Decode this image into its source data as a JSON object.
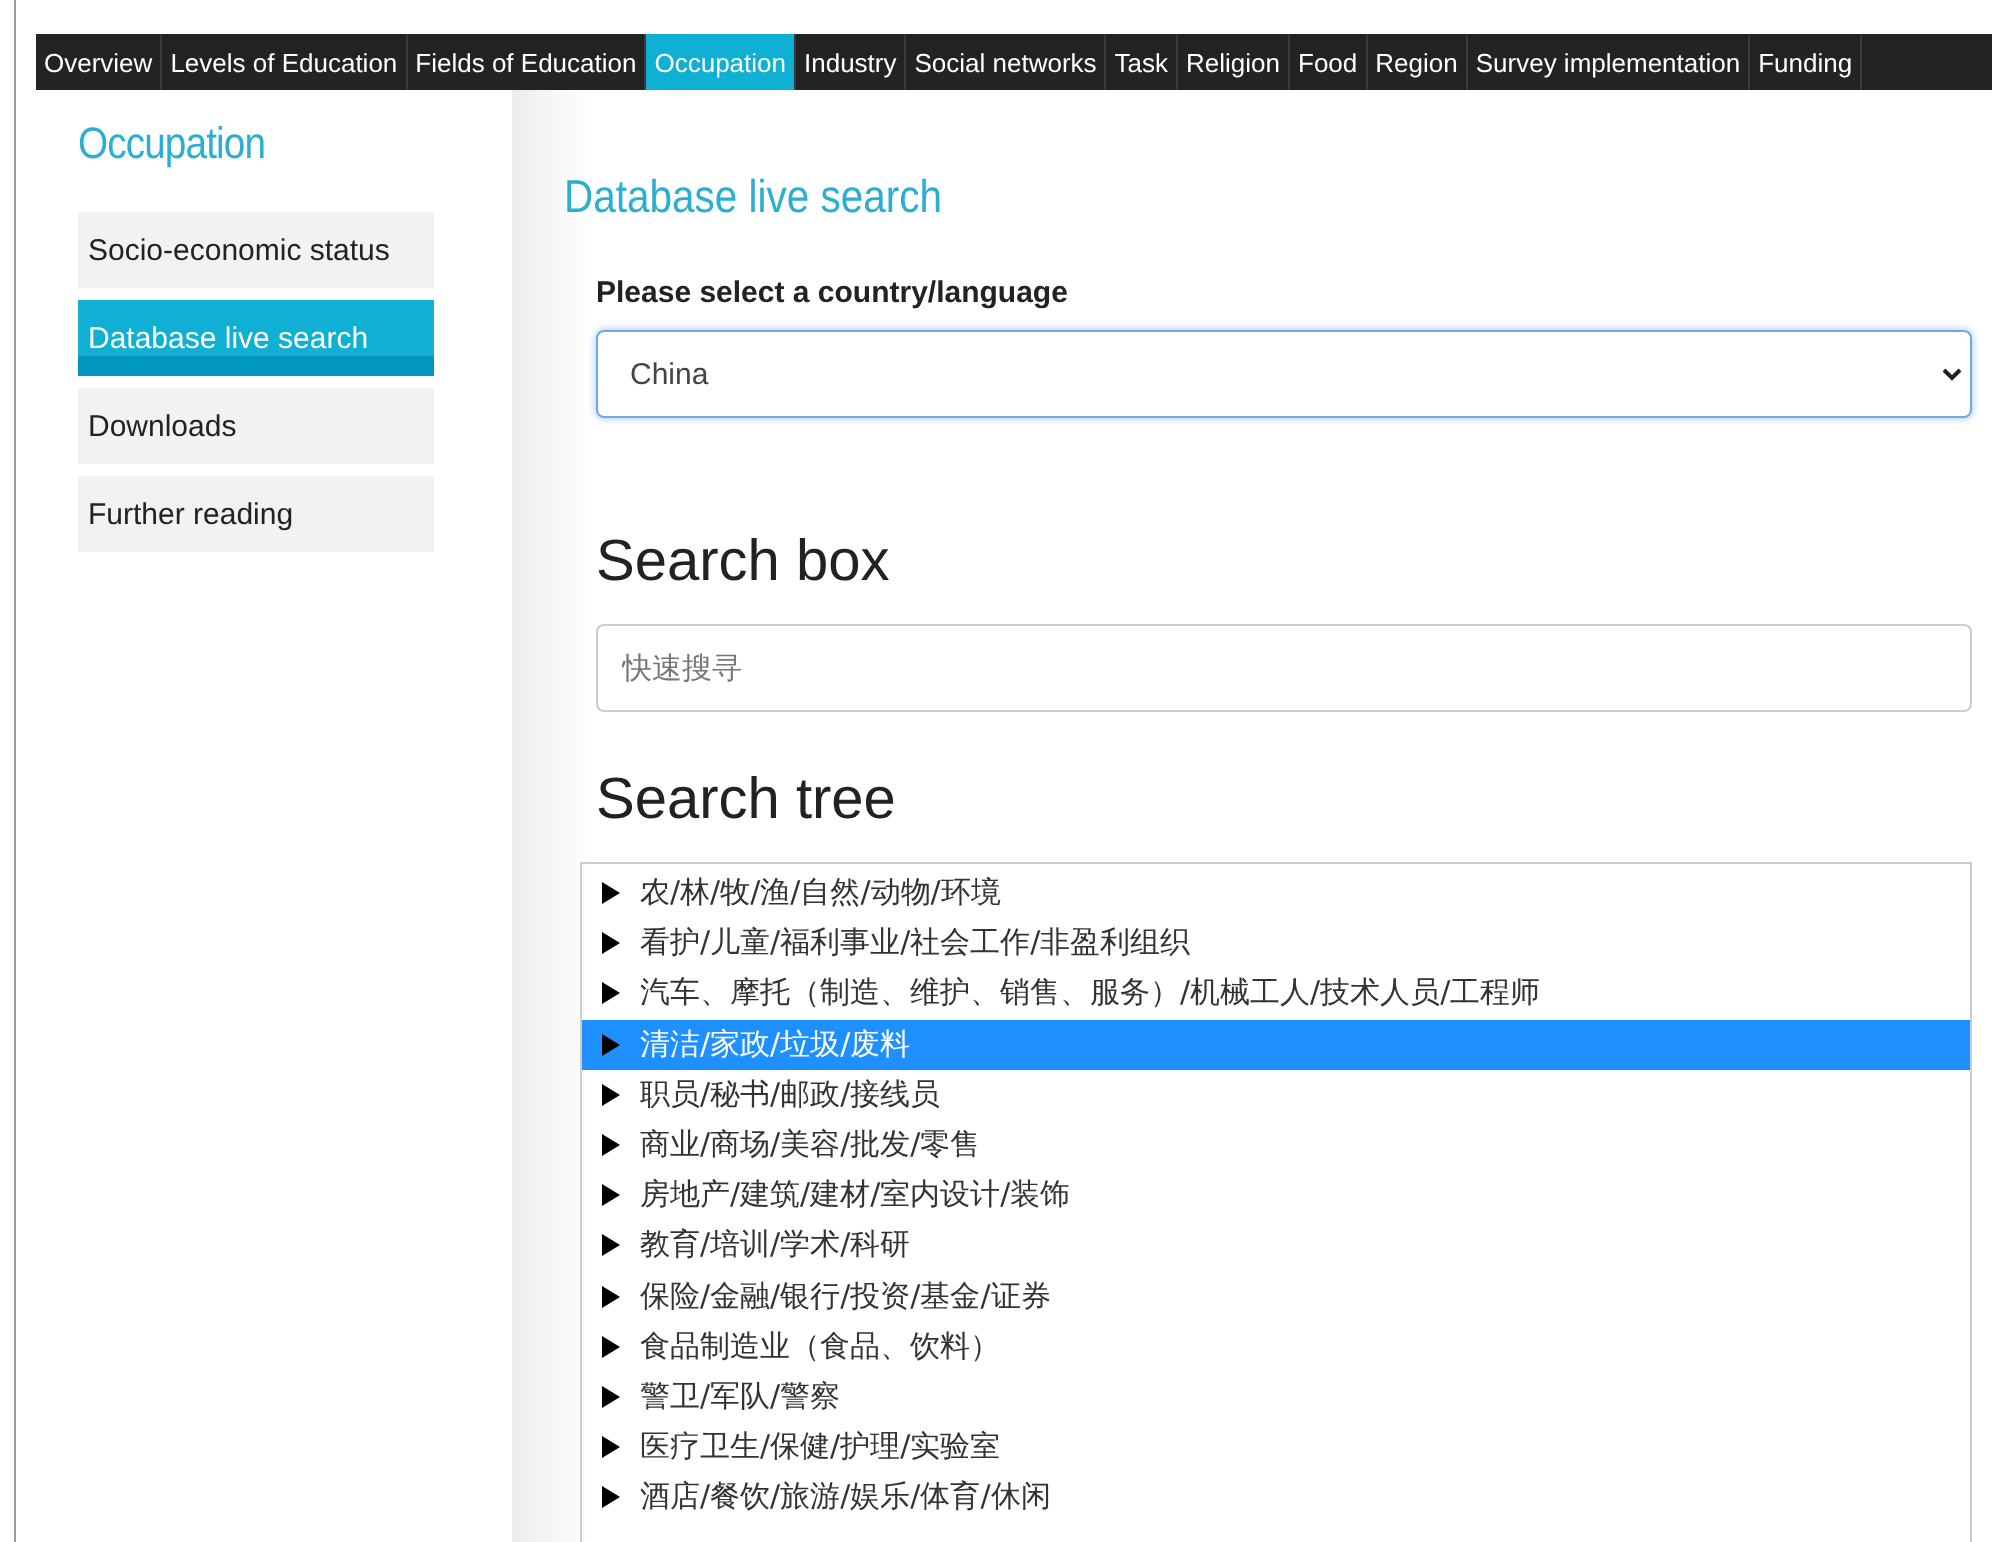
{
  "nav_tabs": [
    {
      "label": "Overview",
      "selected": false
    },
    {
      "label": "Levels of Education",
      "selected": false
    },
    {
      "label": "Fields of Education",
      "selected": false
    },
    {
      "label": "Occupation",
      "selected": true
    },
    {
      "label": "Industry",
      "selected": false
    },
    {
      "label": "Social networks",
      "selected": false
    },
    {
      "label": "Task",
      "selected": false
    },
    {
      "label": "Religion",
      "selected": false
    },
    {
      "label": "Food",
      "selected": false
    },
    {
      "label": "Region",
      "selected": false
    },
    {
      "label": "Survey implementation",
      "selected": false
    },
    {
      "label": "Funding",
      "selected": false
    }
  ],
  "sidebar": {
    "title": "Occupation",
    "items": [
      {
        "label": "Socio-economic status",
        "selected": false
      },
      {
        "label": "Database live search",
        "selected": true
      },
      {
        "label": "Downloads",
        "selected": false
      },
      {
        "label": "Further reading",
        "selected": false
      }
    ]
  },
  "main": {
    "title": "Database live search",
    "country_label": "Please select a country/language",
    "country_select": {
      "value": "China"
    },
    "search_box": {
      "heading": "Search box",
      "placeholder": "快速搜寻"
    },
    "search_tree": {
      "heading": "Search tree",
      "items": [
        {
          "label": "农/林/牧/渔/自然/动物/环境",
          "selected": false,
          "expanded": false
        },
        {
          "label": "看护/儿童/福利事业/社会工作/非盈利组织",
          "selected": false,
          "expanded": false
        },
        {
          "label": "汽车、摩托（制造、维护、销售、服务）/机械工人/技术人员/工程师",
          "selected": false,
          "expanded": false
        },
        {
          "label": "清洁/家政/垃圾/废料",
          "selected": true,
          "expanded": false
        },
        {
          "label": "职员/秘书/邮政/接线员",
          "selected": false,
          "expanded": false
        },
        {
          "label": "商业/商场/美容/批发/零售",
          "selected": false,
          "expanded": false
        },
        {
          "label": "房地产/建筑/建材/室内设计/装饰",
          "selected": false,
          "expanded": false
        },
        {
          "label": "教育/培训/学术/科研",
          "selected": false,
          "expanded": false
        },
        {
          "label": "保险/金融/银行/投资/基金/证券",
          "selected": false,
          "expanded": false
        },
        {
          "label": "食品制造业（食品、饮料）",
          "selected": false,
          "expanded": false
        },
        {
          "label": "警卫/军队/警察",
          "selected": false,
          "expanded": false
        },
        {
          "label": "医疗卫生/保健/护理/实验室",
          "selected": false,
          "expanded": false
        },
        {
          "label": "酒店/餐饮/旅游/娱乐/体育/休闲",
          "selected": false,
          "expanded": false
        }
      ]
    }
  }
}
